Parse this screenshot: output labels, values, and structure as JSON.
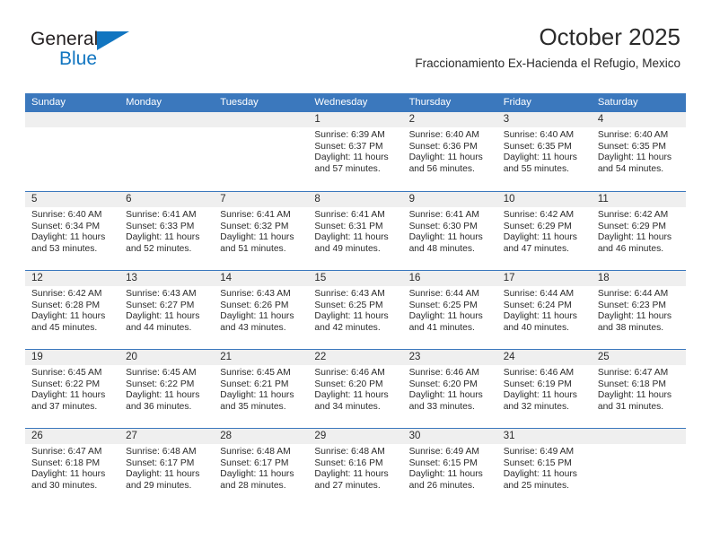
{
  "brand": {
    "name_top": "General",
    "name_bottom": "Blue",
    "triangle_color": "#1175c0"
  },
  "header": {
    "title": "October 2025",
    "subtitle": "Fraccionamiento Ex-Hacienda el Refugio, Mexico"
  },
  "theme": {
    "header_blue": "#3b78bd",
    "band_gray": "#efefef",
    "text": "#2b2b2b"
  },
  "weekdays": [
    "Sunday",
    "Monday",
    "Tuesday",
    "Wednesday",
    "Thursday",
    "Friday",
    "Saturday"
  ],
  "weeks": [
    [
      {
        "day": "",
        "lines": []
      },
      {
        "day": "",
        "lines": []
      },
      {
        "day": "",
        "lines": []
      },
      {
        "day": "1",
        "lines": [
          "Sunrise: 6:39 AM",
          "Sunset: 6:37 PM",
          "Daylight: 11 hours",
          "and 57 minutes."
        ]
      },
      {
        "day": "2",
        "lines": [
          "Sunrise: 6:40 AM",
          "Sunset: 6:36 PM",
          "Daylight: 11 hours",
          "and 56 minutes."
        ]
      },
      {
        "day": "3",
        "lines": [
          "Sunrise: 6:40 AM",
          "Sunset: 6:35 PM",
          "Daylight: 11 hours",
          "and 55 minutes."
        ]
      },
      {
        "day": "4",
        "lines": [
          "Sunrise: 6:40 AM",
          "Sunset: 6:35 PM",
          "Daylight: 11 hours",
          "and 54 minutes."
        ]
      }
    ],
    [
      {
        "day": "5",
        "lines": [
          "Sunrise: 6:40 AM",
          "Sunset: 6:34 PM",
          "Daylight: 11 hours",
          "and 53 minutes."
        ]
      },
      {
        "day": "6",
        "lines": [
          "Sunrise: 6:41 AM",
          "Sunset: 6:33 PM",
          "Daylight: 11 hours",
          "and 52 minutes."
        ]
      },
      {
        "day": "7",
        "lines": [
          "Sunrise: 6:41 AM",
          "Sunset: 6:32 PM",
          "Daylight: 11 hours",
          "and 51 minutes."
        ]
      },
      {
        "day": "8",
        "lines": [
          "Sunrise: 6:41 AM",
          "Sunset: 6:31 PM",
          "Daylight: 11 hours",
          "and 49 minutes."
        ]
      },
      {
        "day": "9",
        "lines": [
          "Sunrise: 6:41 AM",
          "Sunset: 6:30 PM",
          "Daylight: 11 hours",
          "and 48 minutes."
        ]
      },
      {
        "day": "10",
        "lines": [
          "Sunrise: 6:42 AM",
          "Sunset: 6:29 PM",
          "Daylight: 11 hours",
          "and 47 minutes."
        ]
      },
      {
        "day": "11",
        "lines": [
          "Sunrise: 6:42 AM",
          "Sunset: 6:29 PM",
          "Daylight: 11 hours",
          "and 46 minutes."
        ]
      }
    ],
    [
      {
        "day": "12",
        "lines": [
          "Sunrise: 6:42 AM",
          "Sunset: 6:28 PM",
          "Daylight: 11 hours",
          "and 45 minutes."
        ]
      },
      {
        "day": "13",
        "lines": [
          "Sunrise: 6:43 AM",
          "Sunset: 6:27 PM",
          "Daylight: 11 hours",
          "and 44 minutes."
        ]
      },
      {
        "day": "14",
        "lines": [
          "Sunrise: 6:43 AM",
          "Sunset: 6:26 PM",
          "Daylight: 11 hours",
          "and 43 minutes."
        ]
      },
      {
        "day": "15",
        "lines": [
          "Sunrise: 6:43 AM",
          "Sunset: 6:25 PM",
          "Daylight: 11 hours",
          "and 42 minutes."
        ]
      },
      {
        "day": "16",
        "lines": [
          "Sunrise: 6:44 AM",
          "Sunset: 6:25 PM",
          "Daylight: 11 hours",
          "and 41 minutes."
        ]
      },
      {
        "day": "17",
        "lines": [
          "Sunrise: 6:44 AM",
          "Sunset: 6:24 PM",
          "Daylight: 11 hours",
          "and 40 minutes."
        ]
      },
      {
        "day": "18",
        "lines": [
          "Sunrise: 6:44 AM",
          "Sunset: 6:23 PM",
          "Daylight: 11 hours",
          "and 38 minutes."
        ]
      }
    ],
    [
      {
        "day": "19",
        "lines": [
          "Sunrise: 6:45 AM",
          "Sunset: 6:22 PM",
          "Daylight: 11 hours",
          "and 37 minutes."
        ]
      },
      {
        "day": "20",
        "lines": [
          "Sunrise: 6:45 AM",
          "Sunset: 6:22 PM",
          "Daylight: 11 hours",
          "and 36 minutes."
        ]
      },
      {
        "day": "21",
        "lines": [
          "Sunrise: 6:45 AM",
          "Sunset: 6:21 PM",
          "Daylight: 11 hours",
          "and 35 minutes."
        ]
      },
      {
        "day": "22",
        "lines": [
          "Sunrise: 6:46 AM",
          "Sunset: 6:20 PM",
          "Daylight: 11 hours",
          "and 34 minutes."
        ]
      },
      {
        "day": "23",
        "lines": [
          "Sunrise: 6:46 AM",
          "Sunset: 6:20 PM",
          "Daylight: 11 hours",
          "and 33 minutes."
        ]
      },
      {
        "day": "24",
        "lines": [
          "Sunrise: 6:46 AM",
          "Sunset: 6:19 PM",
          "Daylight: 11 hours",
          "and 32 minutes."
        ]
      },
      {
        "day": "25",
        "lines": [
          "Sunrise: 6:47 AM",
          "Sunset: 6:18 PM",
          "Daylight: 11 hours",
          "and 31 minutes."
        ]
      }
    ],
    [
      {
        "day": "26",
        "lines": [
          "Sunrise: 6:47 AM",
          "Sunset: 6:18 PM",
          "Daylight: 11 hours",
          "and 30 minutes."
        ]
      },
      {
        "day": "27",
        "lines": [
          "Sunrise: 6:48 AM",
          "Sunset: 6:17 PM",
          "Daylight: 11 hours",
          "and 29 minutes."
        ]
      },
      {
        "day": "28",
        "lines": [
          "Sunrise: 6:48 AM",
          "Sunset: 6:17 PM",
          "Daylight: 11 hours",
          "and 28 minutes."
        ]
      },
      {
        "day": "29",
        "lines": [
          "Sunrise: 6:48 AM",
          "Sunset: 6:16 PM",
          "Daylight: 11 hours",
          "and 27 minutes."
        ]
      },
      {
        "day": "30",
        "lines": [
          "Sunrise: 6:49 AM",
          "Sunset: 6:15 PM",
          "Daylight: 11 hours",
          "and 26 minutes."
        ]
      },
      {
        "day": "31",
        "lines": [
          "Sunrise: 6:49 AM",
          "Sunset: 6:15 PM",
          "Daylight: 11 hours",
          "and 25 minutes."
        ]
      },
      {
        "day": "",
        "lines": []
      }
    ]
  ]
}
